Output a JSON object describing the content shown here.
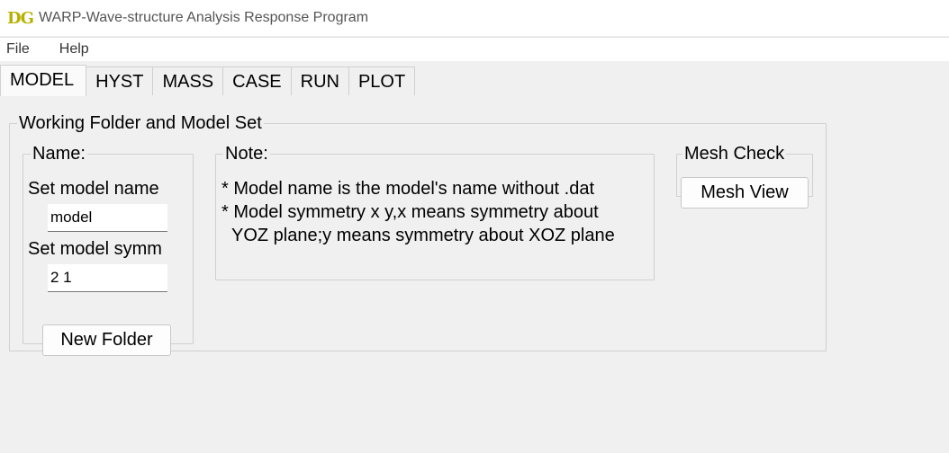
{
  "window": {
    "logo_text": "DG",
    "title": "WARP-Wave-structure Analysis Response Program"
  },
  "menu": {
    "items": [
      "File",
      "Help"
    ]
  },
  "tabs": [
    "MODEL",
    "HYST",
    "MASS",
    "CASE",
    "RUN",
    "PLOT"
  ],
  "active_tab": "MODEL",
  "model_panel": {
    "group_title": "Working Folder and Model Set",
    "name_group": {
      "title": "Name:",
      "model_name_label": "Set model name",
      "model_name_value": "model",
      "model_symm_label": "Set model symm",
      "model_symm_value": "2 1",
      "new_folder_button": "New Folder"
    },
    "note_group": {
      "title": "Note:",
      "lines": [
        "* Model name is the model's name without .dat",
        "* Model symmetry x y,x means symmetry about",
        "YOZ plane;y means symmetry about XOZ plane"
      ]
    },
    "mesh_group": {
      "title": "Mesh Check",
      "mesh_view_button": "Mesh View"
    }
  }
}
